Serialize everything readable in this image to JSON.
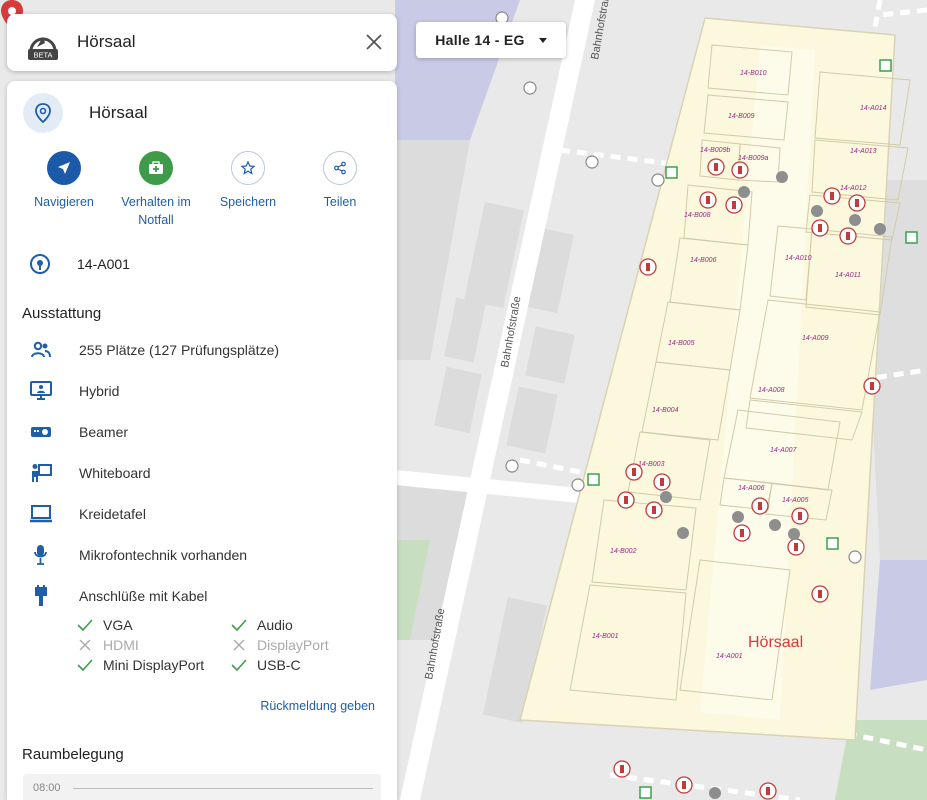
{
  "search": {
    "value": "Hörsaal"
  },
  "logo": {
    "badge": "BETA"
  },
  "floor_select": {
    "label": "Halle 14 - EG"
  },
  "map": {
    "streets": [
      "Bahnhofstraße",
      "Bahnhofstraße",
      "Bahnhofstraße"
    ],
    "partial_label": "14",
    "rooms": [
      "14-B010",
      "14-B009",
      "14-B009b",
      "14-B009a",
      "14-B008",
      "14-B006",
      "14-B005",
      "14-B004",
      "14-B003",
      "14-B002",
      "14-B001",
      "14-A014",
      "14-A013",
      "14-A012",
      "14-A010",
      "14-A011",
      "14-A009",
      "14-A008",
      "14-A007",
      "14-A006",
      "14-A005",
      "14-A001"
    ],
    "pin_label": "Hörsaal"
  },
  "panel": {
    "title": "Hörsaal",
    "actions": [
      {
        "label": "Navigieren",
        "icon": "navigate-icon"
      },
      {
        "label": "Verhalten im Notfall",
        "icon": "first-aid-icon"
      },
      {
        "label": "Speichern",
        "icon": "star-icon"
      },
      {
        "label": "Teilen",
        "icon": "share-icon"
      }
    ],
    "room_number": "14-A001",
    "equipment_title": "Ausstattung",
    "equipment": [
      {
        "label": "255 Plätze (127 Prüfungsplätze)",
        "icon": "people-icon"
      },
      {
        "label": "Hybrid",
        "icon": "hybrid-icon"
      },
      {
        "label": "Beamer",
        "icon": "projector-icon"
      },
      {
        "label": "Whiteboard",
        "icon": "whiteboard-icon"
      },
      {
        "label": "Kreidetafel",
        "icon": "chalkboard-icon"
      },
      {
        "label": "Mikrofontechnik vorhanden",
        "icon": "microphone-icon"
      },
      {
        "label": "Anschlüße mit Kabel",
        "icon": "cable-icon"
      }
    ],
    "ports": [
      {
        "label": "VGA",
        "available": true
      },
      {
        "label": "Audio",
        "available": true
      },
      {
        "label": "HDMI",
        "available": false
      },
      {
        "label": "DisplayPort",
        "available": false
      },
      {
        "label": "Mini DisplayPort",
        "available": true
      },
      {
        "label": "USB-C",
        "available": true
      }
    ],
    "feedback": "Rückmeldung geben",
    "schedule_title": "Raumbelegung",
    "schedule_time": "08:00"
  },
  "colors": {
    "accent": "#1f5ea8",
    "pin": "#d83a3a",
    "room_label": "#9b2a86",
    "building": "#fbf8de"
  }
}
